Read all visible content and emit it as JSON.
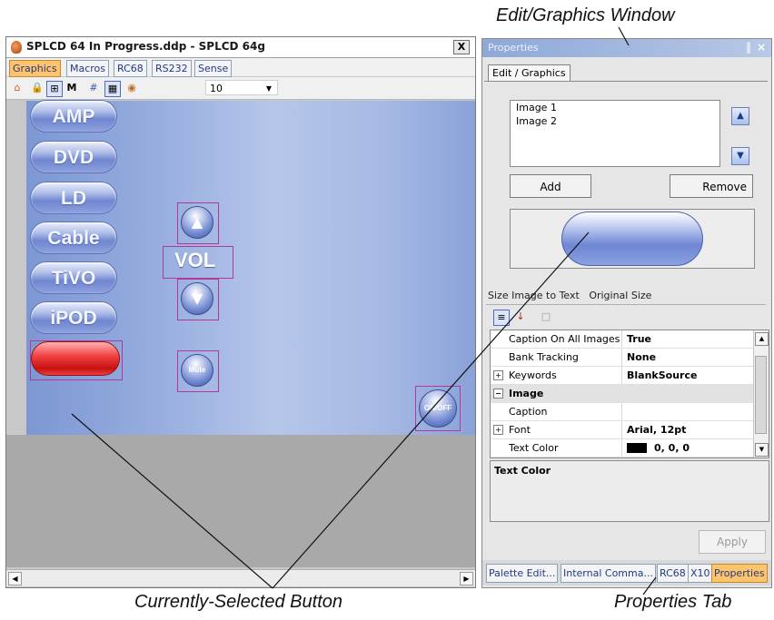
{
  "callouts": {
    "edit_graphics": "Edit/Graphics Window",
    "selected_button": "Currently-Selected Button",
    "properties_tab": "Properties Tab"
  },
  "designer": {
    "title": "SPLCD 64 In Progress.ddp - SPLCD 64g",
    "close_label": "X",
    "tabs": [
      {
        "label": "Graphics",
        "active": true
      },
      {
        "label": "Macros",
        "active": false
      },
      {
        "label": "RC68",
        "active": false
      },
      {
        "label": "RS232",
        "active": false
      },
      {
        "label": "Sense",
        "active": false
      }
    ],
    "zoom_value": "10",
    "source_buttons": [
      "AMP",
      "DVD",
      "LD",
      "Cable",
      "TiVO",
      "iPOD"
    ],
    "vol_label": "VOL",
    "mute_label": "Mute",
    "onoff_label": "ON/OFF"
  },
  "properties": {
    "window_title": "Properties",
    "pin_glyph": "‖",
    "close_glyph": "×",
    "edit_tab_label": "Edit / Graphics",
    "images": [
      "Image 1",
      "Image 2"
    ],
    "add_label": "Add",
    "remove_label": "Remove",
    "size_to_text": "Size Image to Text",
    "original_size": "Original Size",
    "grid_rows": [
      {
        "name": "Caption On All Images",
        "value": "True",
        "expander": ""
      },
      {
        "name": "Bank Tracking",
        "value": "None",
        "expander": ""
      },
      {
        "name": "Keywords",
        "value": "BlankSource",
        "expander": "+"
      },
      {
        "name": "Image",
        "value": "",
        "expander": "−",
        "category": true
      },
      {
        "name": "Caption",
        "value": "",
        "expander": ""
      },
      {
        "name": "Font",
        "value": "Arial, 12pt",
        "expander": "+"
      },
      {
        "name": "Text Color",
        "value": "0, 0, 0",
        "expander": ""
      }
    ],
    "description_title": "Text Color",
    "apply_label": "Apply",
    "bottom_tabs": [
      {
        "label": "Palette Edit...",
        "active": false
      },
      {
        "label": "Internal Comma...",
        "active": false
      },
      {
        "label": "RC68",
        "active": false
      },
      {
        "label": "X10",
        "active": false
      },
      {
        "label": "Properties",
        "active": true
      }
    ]
  },
  "colors": {
    "active_tab": "#ffc36b",
    "selected_button": "#e02020",
    "button_blue": "#7086cf",
    "selection_outline": "#b03a9a"
  }
}
